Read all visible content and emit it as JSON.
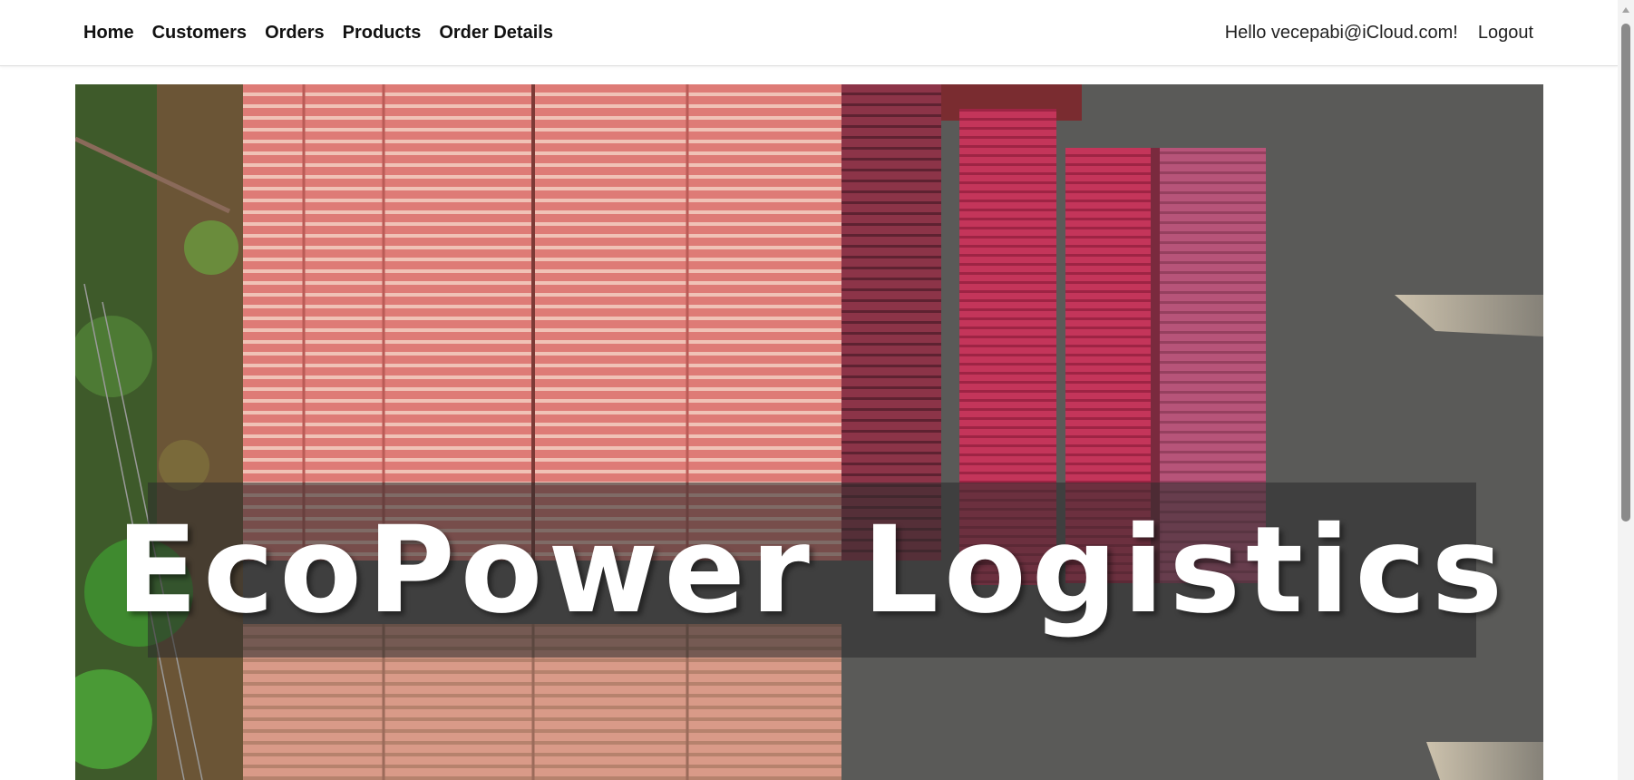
{
  "nav": {
    "links": [
      "Home",
      "Customers",
      "Orders",
      "Products",
      "Order Details"
    ],
    "greeting": "Hello vecepabi@iCloud.com!",
    "logout": "Logout"
  },
  "hero": {
    "title": "EcoPower Logistics"
  },
  "colors": {
    "nav_background": "#ffffff",
    "nav_text": "#111111",
    "title_band": "rgba(45,45,45,0.58)",
    "container_salmon": "#de7b76",
    "container_crimson": "#c4355a",
    "container_pink": "#b75479",
    "ground": "#5a5a58"
  }
}
